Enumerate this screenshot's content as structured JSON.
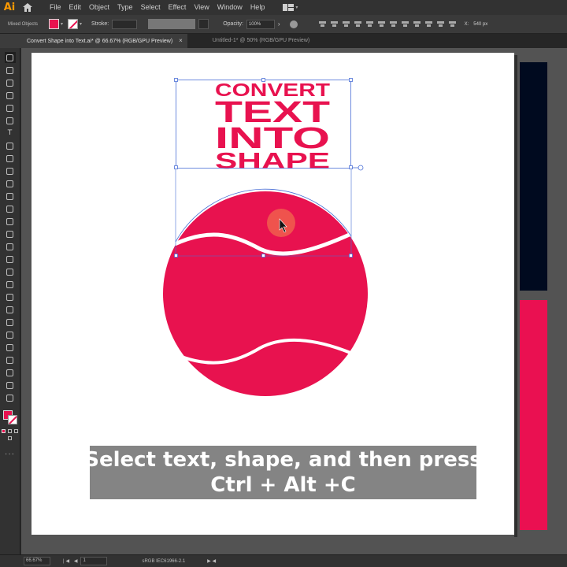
{
  "app": {
    "logo": "Ai",
    "menu": [
      "File",
      "Edit",
      "Object",
      "Type",
      "Select",
      "Effect",
      "View",
      "Window",
      "Help"
    ]
  },
  "control": {
    "selection_label": "Mixed Objects",
    "fill_color": "#e8124f",
    "stroke_label": "Stroke:",
    "opacity_label": "Opacity:",
    "opacity_value": "100%",
    "x_label": "X:",
    "x_value": "540 px"
  },
  "tabs": [
    {
      "label": "Convert Shape into Text.ai* @ 66.67% (RGB/GPU Preview)",
      "close": "×",
      "active": true
    },
    {
      "label": "Untitled-1* @ 50% (RGB/GPU Preview)",
      "active": false
    }
  ],
  "artwork": {
    "lines": [
      "CONVERT",
      "TEXT",
      "INTO",
      "SHAPE"
    ],
    "accent_color": "#e8124f",
    "swatch_dark": "#000a1f",
    "swatch_pink": "#ea1051"
  },
  "caption": {
    "line1": "Select text, shape, and then press",
    "line2": "Ctrl + Alt +C"
  },
  "status": {
    "zoom": "66.67%",
    "nav": "|◀ ◀",
    "page": "1",
    "color_profile": "sRGB IEC61966-2.1",
    "arrow": "▶ ◀"
  }
}
